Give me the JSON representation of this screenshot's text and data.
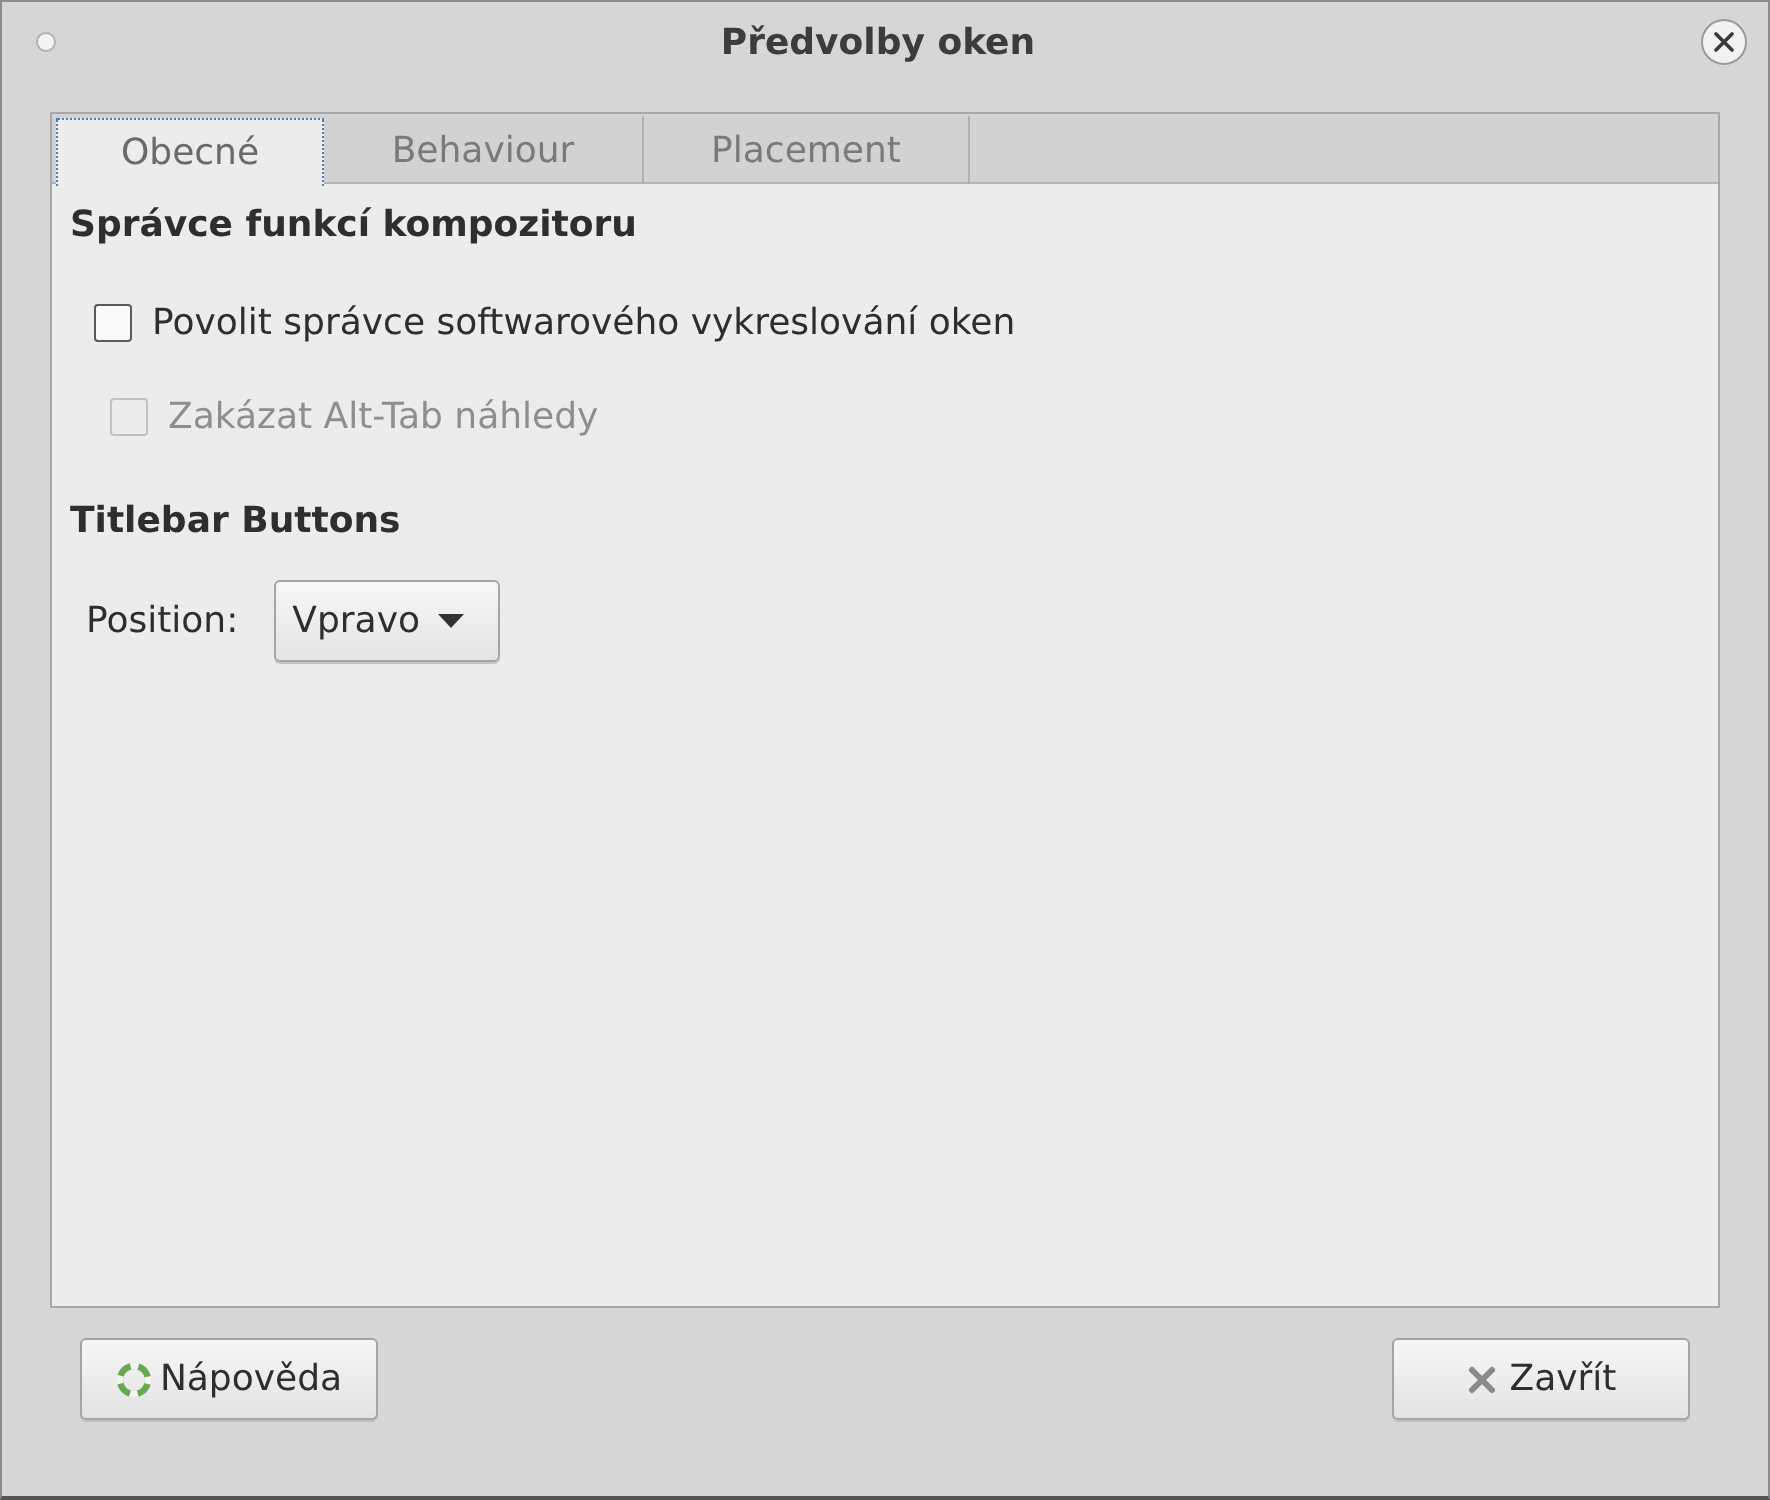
{
  "window": {
    "title": "Předvolby oken"
  },
  "tabs": [
    {
      "label": "Obecné",
      "selected": true
    },
    {
      "label": "Behaviour",
      "selected": false
    },
    {
      "label": "Placement",
      "selected": false
    }
  ],
  "sections": [
    {
      "title": "Správce funkcí kompozitoru",
      "items": [
        {
          "kind": "checkbox",
          "label": "Povolit správce softwarového vykreslování oken",
          "checked": false,
          "disabled": false,
          "children": [
            {
              "kind": "checkbox",
              "label": "Zakázat Alt-Tab náhledy",
              "checked": false,
              "disabled": true
            }
          ]
        }
      ]
    },
    {
      "title": "Titlebar Buttons",
      "items": [
        {
          "kind": "dropdown",
          "label": "Position:",
          "value": "Vpravo"
        }
      ]
    }
  ],
  "buttons": [
    {
      "kind": "help",
      "label": "Nápověda"
    },
    {
      "kind": "close",
      "label": "Zavřít"
    }
  ]
}
